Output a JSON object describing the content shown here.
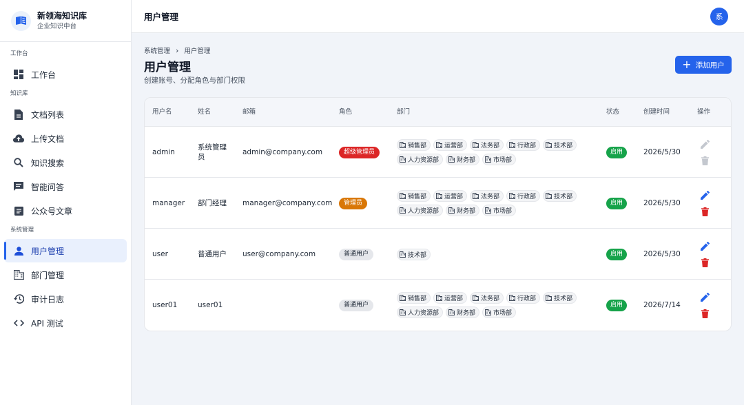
{
  "brand": {
    "title": "新领海知识库",
    "subtitle": "企业知识中台"
  },
  "nav": {
    "sections": [
      {
        "label": "工作台"
      },
      {
        "label": "知识库"
      },
      {
        "label": "系统管理"
      }
    ],
    "items": [
      {
        "label": "工作台",
        "icon": "dashboard-icon"
      },
      {
        "label": "文档列表",
        "icon": "document-icon"
      },
      {
        "label": "上传文档",
        "icon": "cloud-upload-icon"
      },
      {
        "label": "知识搜索",
        "icon": "search-icon"
      },
      {
        "label": "智能问答",
        "icon": "chat-icon"
      },
      {
        "label": "公众号文章",
        "icon": "article-icon"
      },
      {
        "label": "用户管理",
        "icon": "person-icon",
        "active": true
      },
      {
        "label": "部门管理",
        "icon": "building-icon"
      },
      {
        "label": "审计日志",
        "icon": "history-icon"
      },
      {
        "label": "API 测试",
        "icon": "code-icon"
      }
    ]
  },
  "topbar": {
    "title": "用户管理",
    "avatar": "系"
  },
  "breadcrumb": {
    "parent": "系统管理",
    "current": "用户管理"
  },
  "page": {
    "title": "用户管理",
    "description": "创建账号、分配角色与部门权限",
    "add_button": "添加用户"
  },
  "table": {
    "headers": [
      "用户名",
      "姓名",
      "邮箱",
      "角色",
      "部门",
      "状态",
      "创建时间",
      "操作"
    ],
    "rows": [
      {
        "username": "admin",
        "name": "系统管理员",
        "email": "admin@company.com",
        "role": "超级管理员",
        "role_color": "#dc2626",
        "depts": [
          "销售部",
          "运营部",
          "法务部",
          "行政部",
          "技术部",
          "人力资源部",
          "财务部",
          "市场部"
        ],
        "status": "启用",
        "created": "2026/5/30",
        "editable": false
      },
      {
        "username": "manager",
        "name": "部门经理",
        "email": "manager@company.com",
        "role": "管理员",
        "role_color": "#d97706",
        "depts": [
          "销售部",
          "运营部",
          "法务部",
          "行政部",
          "技术部",
          "人力资源部",
          "财务部",
          "市场部"
        ],
        "status": "启用",
        "created": "2026/5/30",
        "editable": true
      },
      {
        "username": "user",
        "name": "普通用户",
        "email": "user@company.com",
        "role": "普通用户",
        "role_color": "#e5e7eb",
        "depts": [
          "技术部"
        ],
        "status": "启用",
        "created": "2026/5/30",
        "editable": true
      },
      {
        "username": "user01",
        "name": "user01",
        "email": "",
        "role": "普通用户",
        "role_color": "#e5e7eb",
        "depts": [
          "销售部",
          "运营部",
          "法务部",
          "行政部",
          "技术部",
          "人力资源部",
          "财务部",
          "市场部"
        ],
        "status": "启用",
        "created": "2026/7/14",
        "editable": true
      }
    ]
  },
  "colors": {
    "primary": "#2563eb",
    "danger": "#dc2626",
    "warning": "#d97706",
    "success": "#16a34a",
    "disabled": "#c4c8cf"
  }
}
